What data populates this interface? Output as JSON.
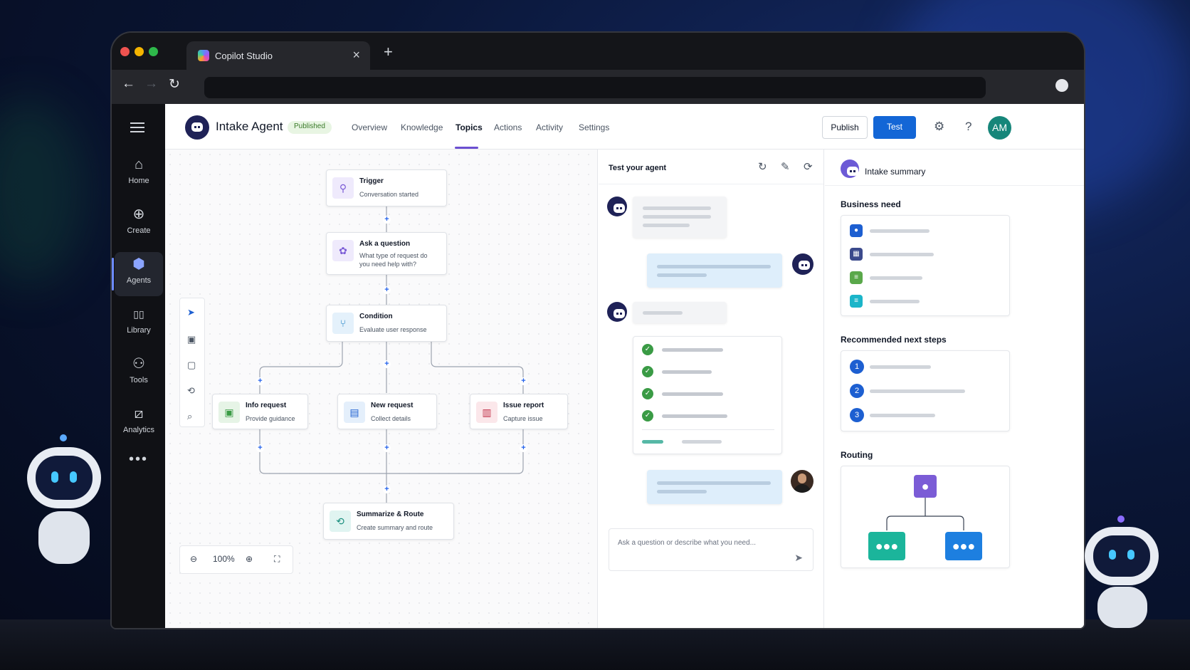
{
  "browser": {
    "tab_title": "Copilot Studio",
    "close_glyph": "×",
    "new_tab_glyph": "+",
    "back_glyph": "←",
    "forward_glyph": "→",
    "reload_glyph": "↻"
  },
  "sidebar": {
    "items": [
      {
        "label": "Home",
        "icon": "⌂"
      },
      {
        "label": "Create",
        "icon": "⊕"
      },
      {
        "label": "Agents",
        "icon": "⬢"
      },
      {
        "label": "Library",
        "icon": "▯▯"
      },
      {
        "label": "Tools",
        "icon": "⚇"
      },
      {
        "label": "Analytics",
        "icon": "⧄"
      }
    ],
    "more": "•••",
    "active_index": 2
  },
  "header": {
    "agent_name": "Intake Agent",
    "status": "Published",
    "tabs": [
      "Overview",
      "Knowledge",
      "Topics",
      "Actions",
      "Activity",
      "Settings"
    ],
    "active_tab": "Topics",
    "publish_label": "Publish",
    "test_label": "Test",
    "settings_icon": "⚙",
    "help_icon": "?",
    "user_initials": "AM"
  },
  "canvas": {
    "nodes": {
      "trigger": {
        "title": "Trigger",
        "subtitle": "Conversation started",
        "icon": "⚲"
      },
      "ask": {
        "title": "Ask a question",
        "subtitle": "What type of request do you need help with?",
        "icon": "✿"
      },
      "condition": {
        "title": "Condition",
        "subtitle": "Evaluate user response",
        "icon": "⑂"
      },
      "info": {
        "title": "Info request",
        "subtitle": "Provide guidance",
        "icon": "▣"
      },
      "new": {
        "title": "New request",
        "subtitle": "Collect details",
        "icon": "▤"
      },
      "issue": {
        "title": "Issue report",
        "subtitle": "Capture issue",
        "icon": "▥"
      },
      "summarize": {
        "title": "Summarize & Route",
        "subtitle": "Create summary and route",
        "icon": "⟲"
      }
    },
    "plus_glyph": "+",
    "zoom": "100%",
    "zoom_out_icon": "⊖",
    "zoom_in_icon": "⊕",
    "fit_icon": "⛶"
  },
  "chat": {
    "title": "Test your agent",
    "input_placeholder": "Ask a question or describe what you need...",
    "send_icon": "➤",
    "reset_icon": "↻",
    "pin_icon": "✎",
    "refresh_icon": "⟳"
  },
  "summary": {
    "title": "Intake summary",
    "business_need": "Business need",
    "next_steps": "Recommended next steps",
    "routing": "Routing",
    "steps": [
      "1",
      "2",
      "3"
    ],
    "colors": {
      "blue": "#1d5fd1",
      "purple": "#7b5cd6",
      "teal": "#1bb59b",
      "green": "#5aa84a"
    }
  }
}
